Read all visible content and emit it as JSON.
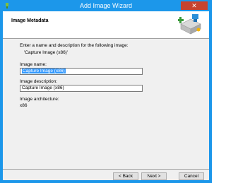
{
  "window": {
    "title": "Add Image Wizard",
    "close_glyph": "✕"
  },
  "header": {
    "title": "Image Metadata",
    "icon": "wizard-server-icon"
  },
  "intro": {
    "text": "Enter a name and description for the following image:",
    "image": "'Capture Image (x86)'"
  },
  "name": {
    "label": "Image name:",
    "value": "Capture Image (x86)"
  },
  "description": {
    "label": "Image description:",
    "value": "Capture Image (x86)"
  },
  "architecture": {
    "label": "Image architecture:",
    "value": "x86"
  },
  "buttons": {
    "back": "< Back",
    "next": "Next >",
    "cancel": "Cancel"
  },
  "colors": {
    "titlebar": "#1c97ea",
    "selection": "#3399ff",
    "close": "#c7432f"
  }
}
